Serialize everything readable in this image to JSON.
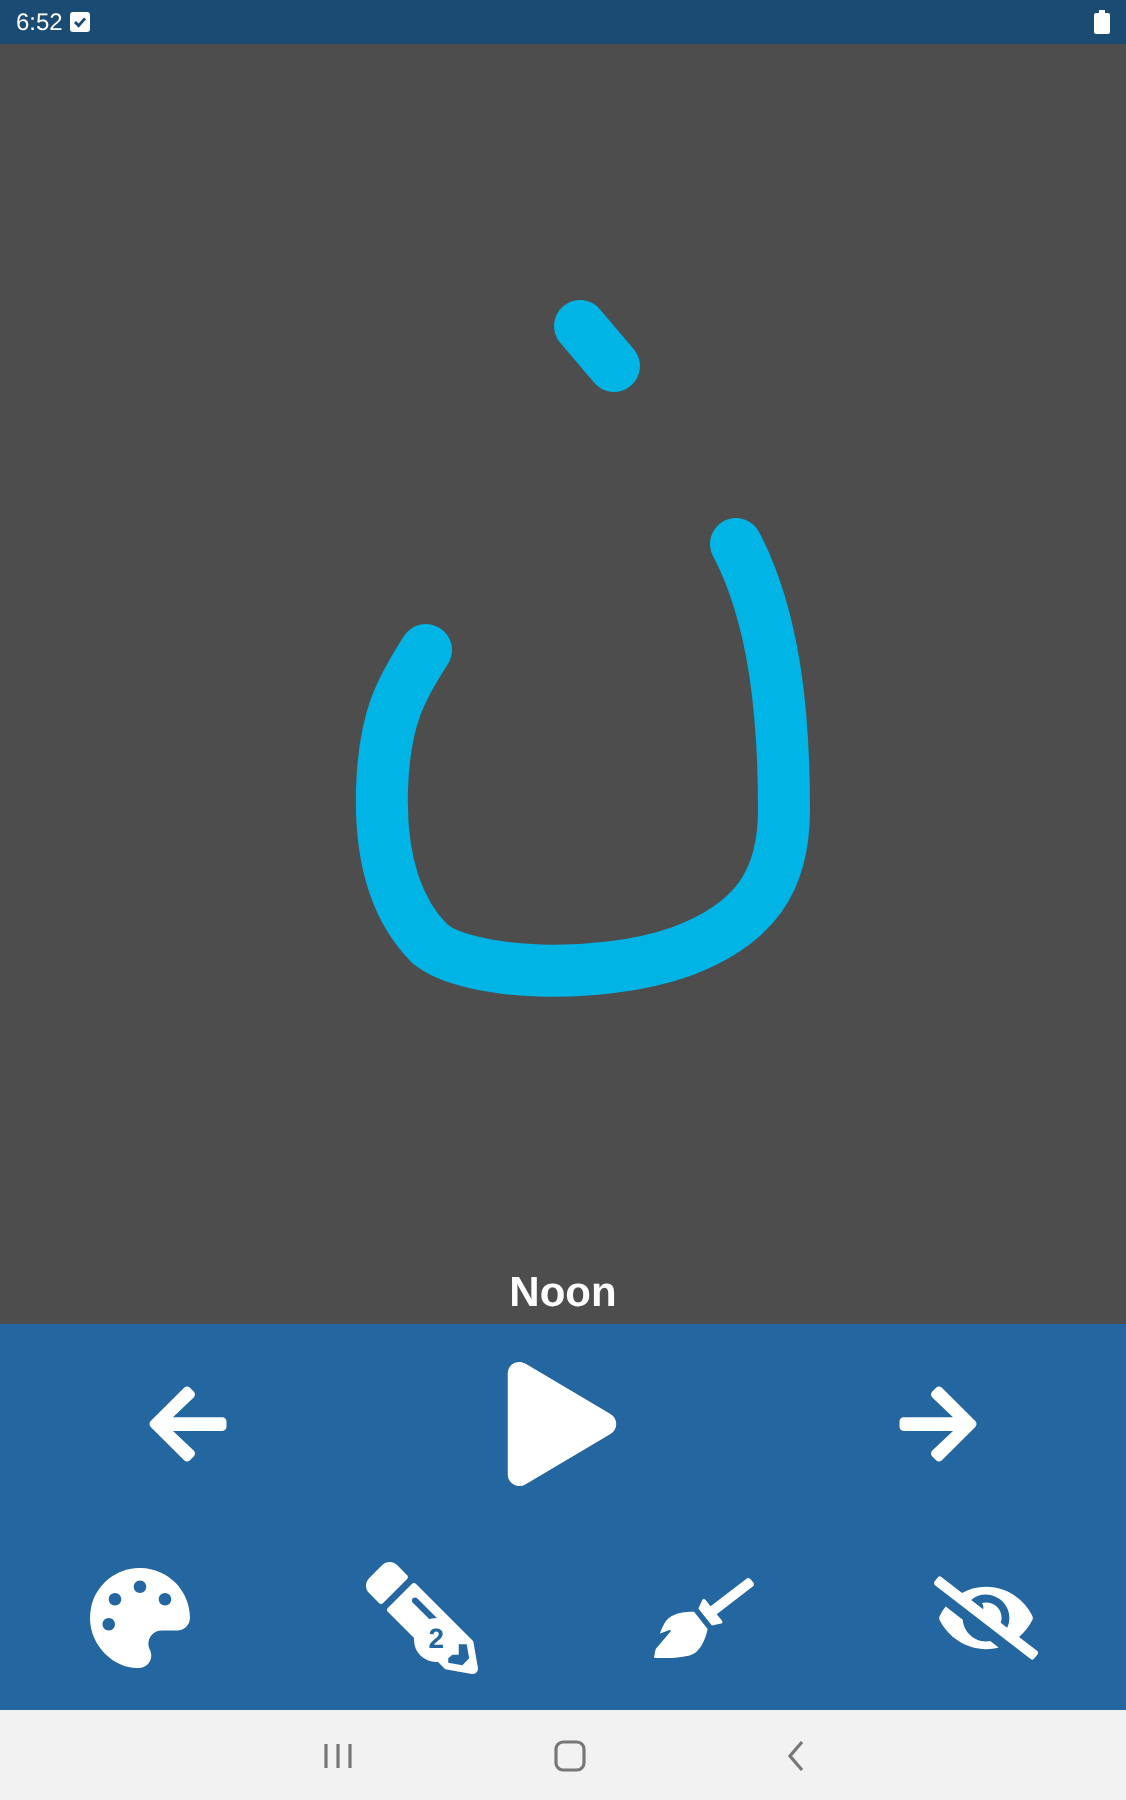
{
  "status_bar": {
    "time": "6:52"
  },
  "letter": {
    "name": "Noon"
  },
  "toolbar": {
    "pen_size": "2"
  }
}
